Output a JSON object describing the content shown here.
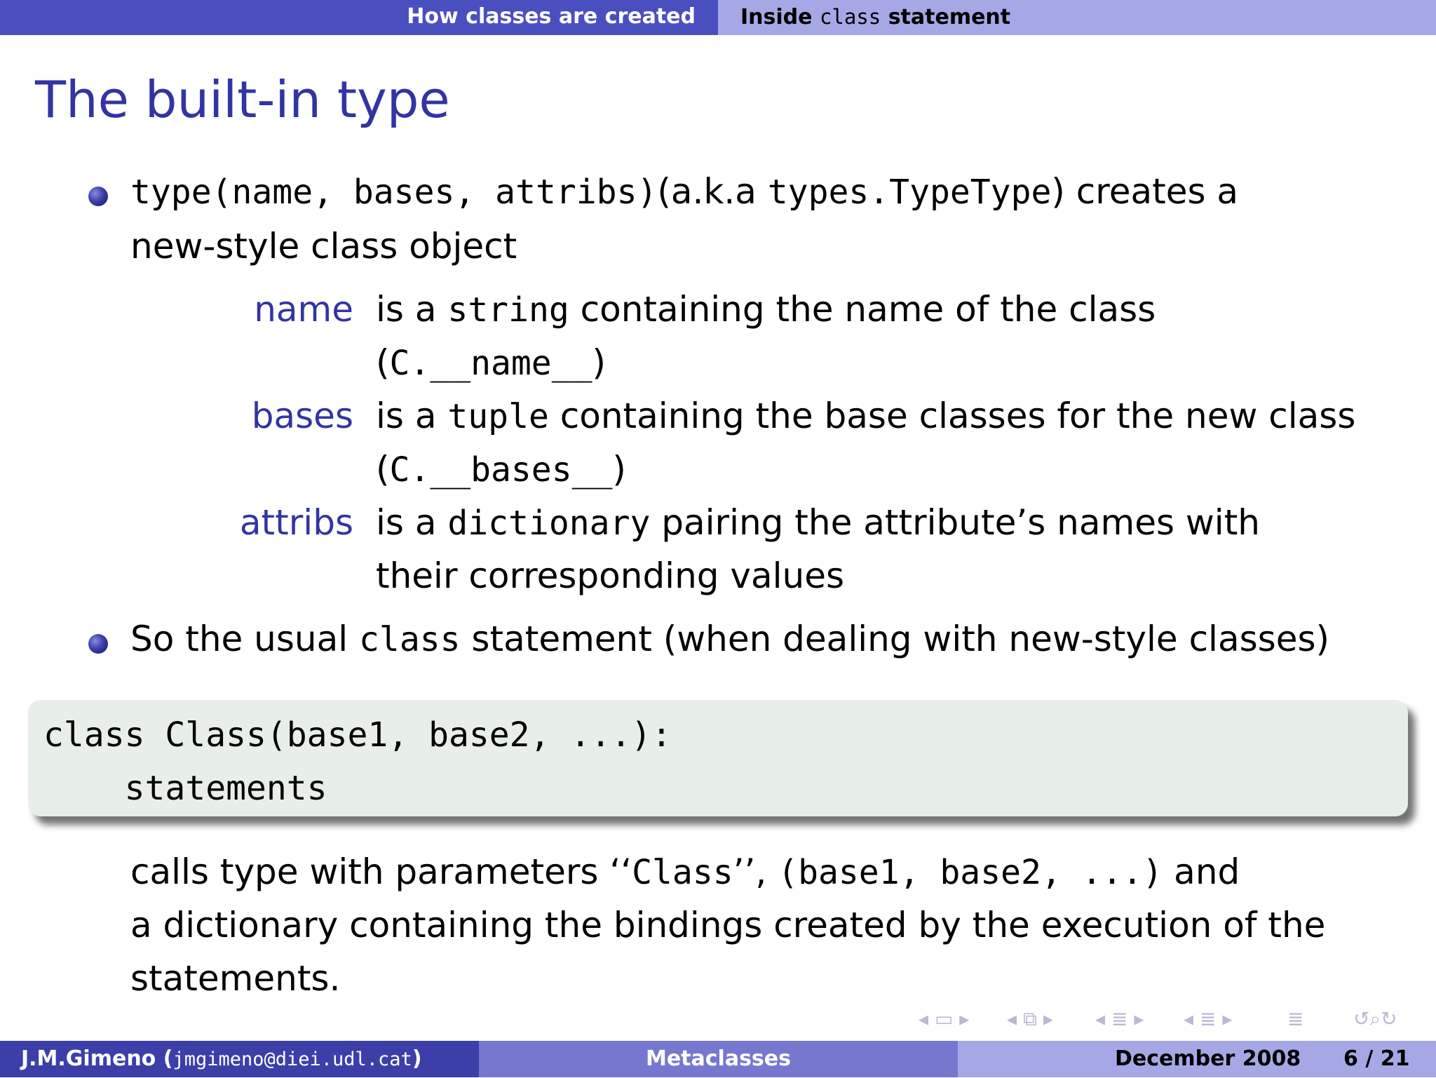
{
  "header": {
    "section_left": "How classes are created",
    "section_right_prefix": "Inside ",
    "section_right_code": "class",
    "section_right_suffix": " statement"
  },
  "title": "The built-in type",
  "bullet1": {
    "code": "type(name, bases, attribs)",
    "aka_prefix": "(a.k.a ",
    "aka_code": "types.TypeType",
    "aka_suffix": ") creates a",
    "line2": "new-style class object"
  },
  "definitions": [
    {
      "term": "name",
      "line1_prefix": "is a ",
      "line1_code": "string",
      "line1_suffix": " containing the name of the class",
      "line2_open": "(",
      "line2_code": "C.__name__",
      "line2_close": ")"
    },
    {
      "term": "bases",
      "line1_prefix": "is a ",
      "line1_code": "tuple",
      "line1_suffix": " containing the base classes for the new class",
      "line2_open": "(",
      "line2_code": "C.__bases__",
      "line2_close": ")"
    },
    {
      "term": "attribs",
      "line1_prefix": "is a ",
      "line1_code": "dictionary",
      "line1_suffix": " pairing the attribute’s names with",
      "line2_text": "their corresponding values"
    }
  ],
  "bullet2": {
    "prefix": "So the usual ",
    "code": "class",
    "suffix": " statement (when dealing with new-style classes)"
  },
  "code_block": {
    "line1": "class Class(base1, base2, ...):",
    "line2": "    statements"
  },
  "after_code": {
    "line1_prefix": "calls type with parameters ",
    "line1_quote_open": "‘‘",
    "line1_code1": "Class",
    "line1_quote_close": "’’, ",
    "line1_code2": "(base1, base2, ...)",
    "line1_suffix": " and",
    "line2": "a dictionary containing the bindings created by the execution of the",
    "line3": "statements."
  },
  "footer": {
    "author_name": "J.M.Gimeno",
    "author_email_open": " (",
    "author_email": "jmgimeno@diei.udl.cat",
    "author_email_close": ")",
    "talk_title": "Metaclasses",
    "date": "December 2008",
    "page": "6 / 21"
  },
  "colors": {
    "header_left": "#4a4fc0",
    "header_right": "#a6a8e6",
    "title": "#3334a3",
    "code_bg": "#e8efe8",
    "footer_left": "#3c3fa8",
    "footer_mid": "#7678cf",
    "footer_right": "#a6a8e6"
  },
  "nav_icons": [
    "nav-frame-icon",
    "nav-subsection-icon",
    "nav-section-icon",
    "nav-section-list-icon",
    "nav-outline-icon",
    "nav-search-icon"
  ]
}
